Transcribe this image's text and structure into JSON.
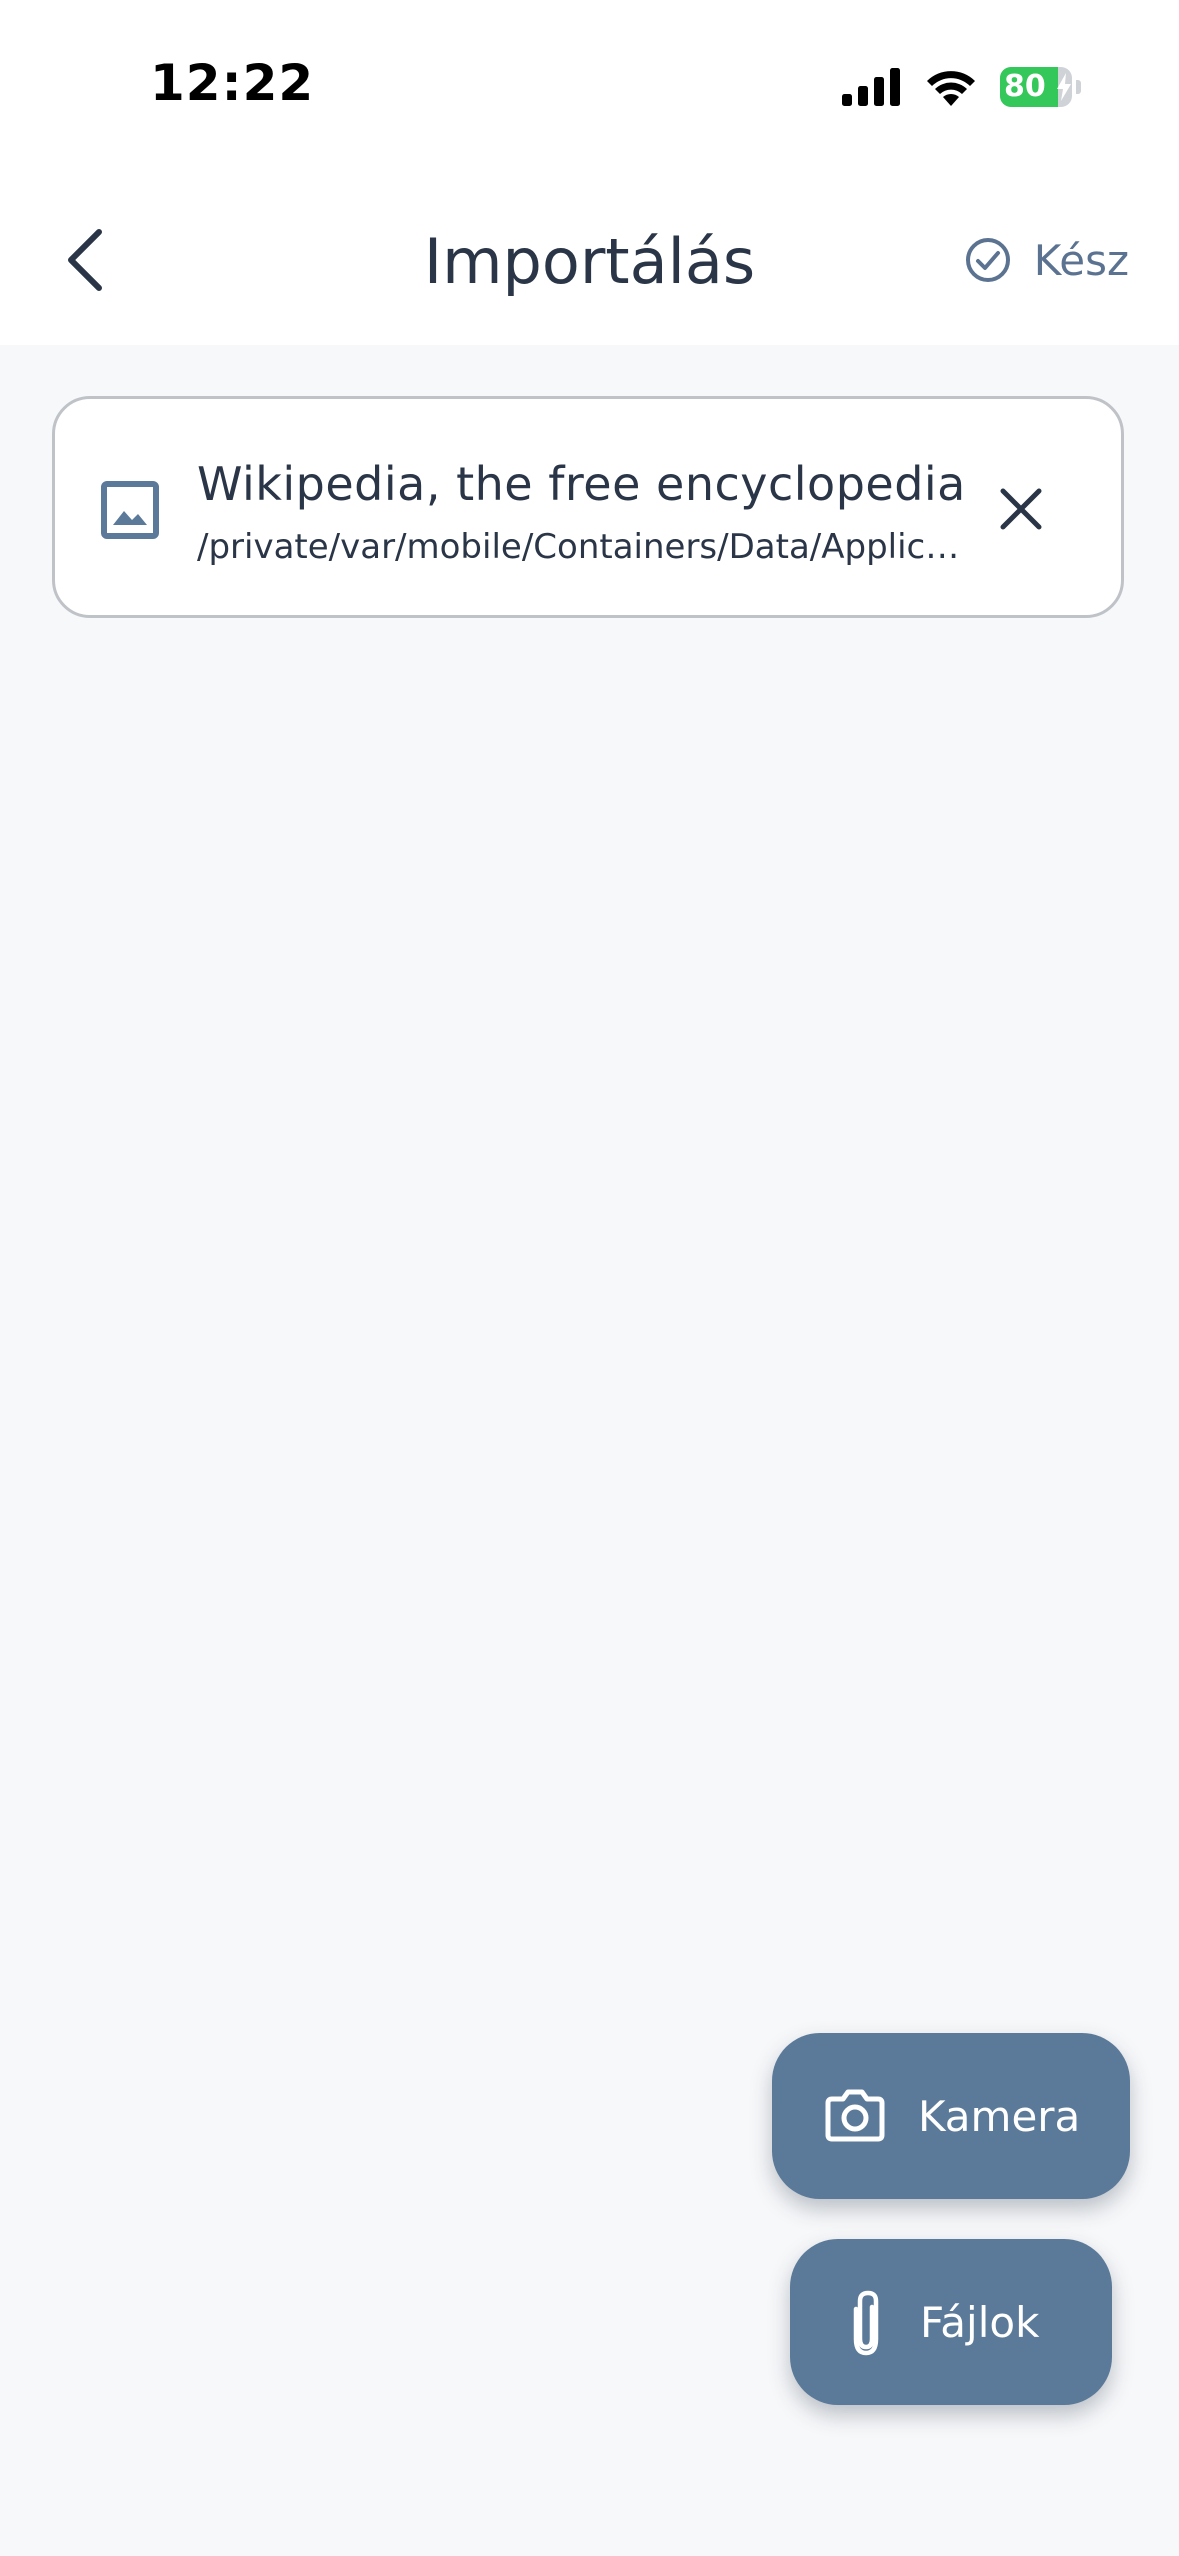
{
  "status_bar": {
    "time": "12:22",
    "battery_level": "80",
    "battery_fraction": 0.8,
    "battery_color": "#34c759"
  },
  "nav": {
    "back_icon": "chevron-left-icon",
    "title": "Importálás",
    "done_icon": "check-circle-icon",
    "done_label": "Kész"
  },
  "file": {
    "icon": "image-icon",
    "name": "Wikipedia, the free encyclopedia",
    "path": "/private/var/mobile/Containers/Data/Application",
    "remove_icon": "close-icon"
  },
  "actions": {
    "camera": {
      "icon": "camera-icon",
      "label": "Kamera"
    },
    "files": {
      "icon": "paperclip-icon",
      "label": "Fájlok"
    }
  },
  "colors": {
    "accent": "#5b7a99",
    "text": "#2a3647",
    "background": "#f7f8fa"
  }
}
